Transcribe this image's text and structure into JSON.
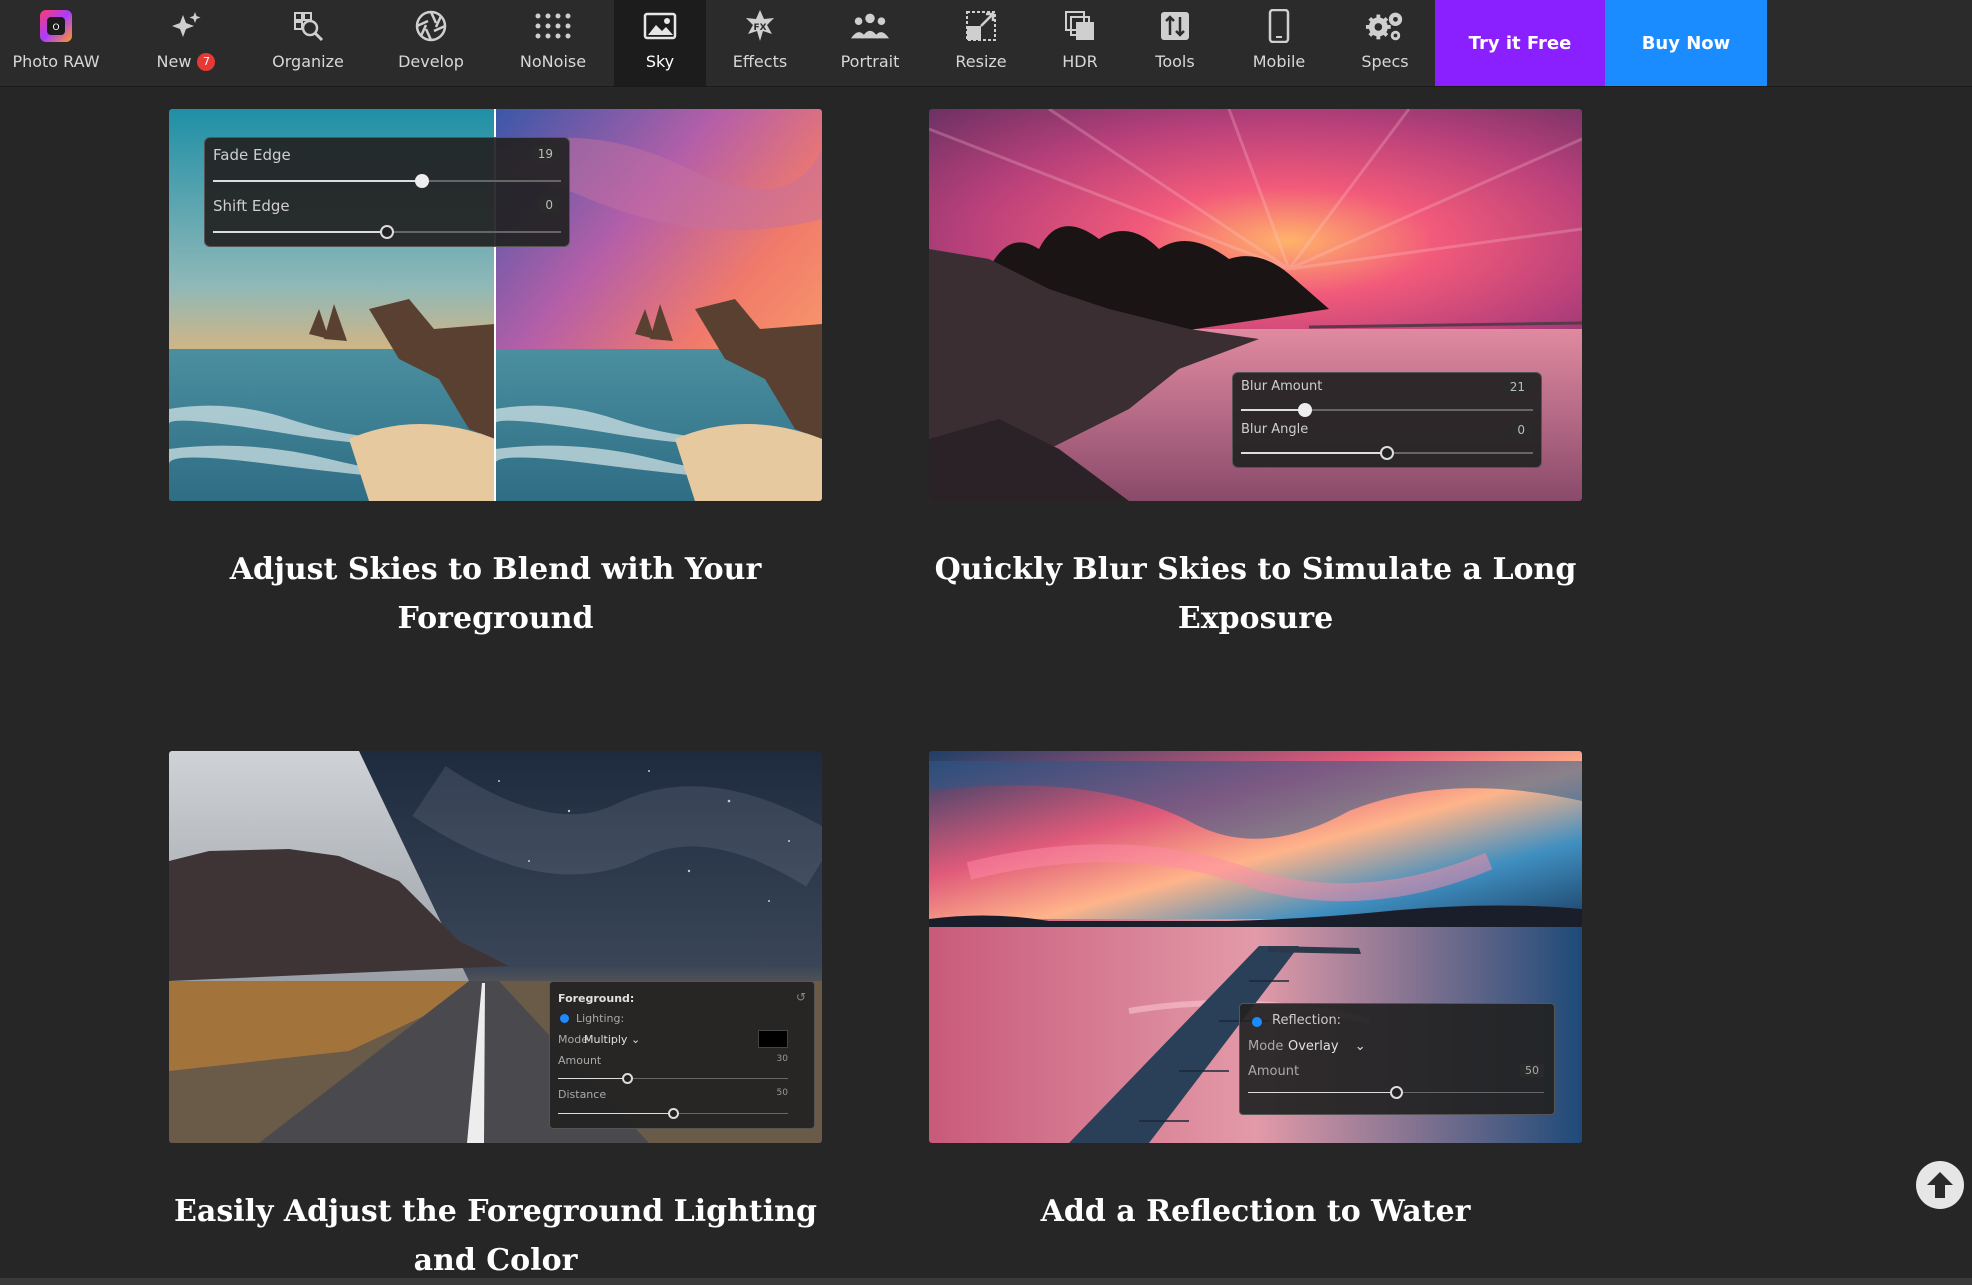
{
  "nav": {
    "items": [
      {
        "label": "Photo RAW",
        "icon": "photo-raw-logo-icon"
      },
      {
        "label": "New",
        "icon": "sparkle-star-icon",
        "badge": "7"
      },
      {
        "label": "Organize",
        "icon": "magnifier-grid-icon"
      },
      {
        "label": "Develop",
        "icon": "aperture-icon"
      },
      {
        "label": "NoNoise",
        "icon": "dot-grid-icon"
      },
      {
        "label": "Sky",
        "icon": "sky-image-icon",
        "active": true
      },
      {
        "label": "Effects",
        "icon": "fx-star-icon"
      },
      {
        "label": "Portrait",
        "icon": "people-icon"
      },
      {
        "label": "Resize",
        "icon": "resize-arrow-icon"
      },
      {
        "label": "HDR",
        "icon": "layers-icon"
      },
      {
        "label": "Tools",
        "icon": "toolbox-icon"
      },
      {
        "label": "Mobile",
        "icon": "phone-icon"
      },
      {
        "label": "Specs",
        "icon": "gears-icon"
      }
    ],
    "try_label": "Try it Free",
    "buy_label": "Buy Now"
  },
  "cards": {
    "blend": {
      "title_line1": "Adjust Skies to Blend with Your",
      "title_line2": "Foreground",
      "panel": {
        "fade_label": "Fade Edge",
        "fade_value": "19",
        "fade_level": 0.6,
        "shift_label": "Shift Edge",
        "shift_value": "0",
        "shift_level": 0.5
      }
    },
    "blur": {
      "title_line1": "Quickly Blur Skies to Simulate a Long",
      "title_line2": "Exposure",
      "panel": {
        "amount_label": "Blur Amount",
        "amount_value": "21",
        "amount_level": 0.22,
        "angle_label": "Blur Angle",
        "angle_value": "0",
        "angle_level": 0.5
      }
    },
    "foreground": {
      "title_line1": "Easily Adjust the Foreground Lighting",
      "title_line2": "and Color",
      "panel": {
        "header": "Foreground:",
        "lighting_label": "Lighting:",
        "mode_label": "Mode",
        "mode_value": "Multiply",
        "amount_label": "Amount",
        "amount_value": "30",
        "amount_level": 0.3,
        "distance_label": "Distance",
        "distance_value": "50",
        "distance_level": 0.5
      }
    },
    "reflection": {
      "title_line1": "Add a Reflection to Water",
      "panel": {
        "header": "Reflection:",
        "mode_label": "Mode",
        "mode_value": "Overlay",
        "amount_label": "Amount",
        "amount_value": "50",
        "amount_level": 0.5
      }
    }
  },
  "colors": {
    "try_bg": "#8a1fff",
    "buy_bg": "#1a8cff",
    "page_bg": "#262626"
  }
}
